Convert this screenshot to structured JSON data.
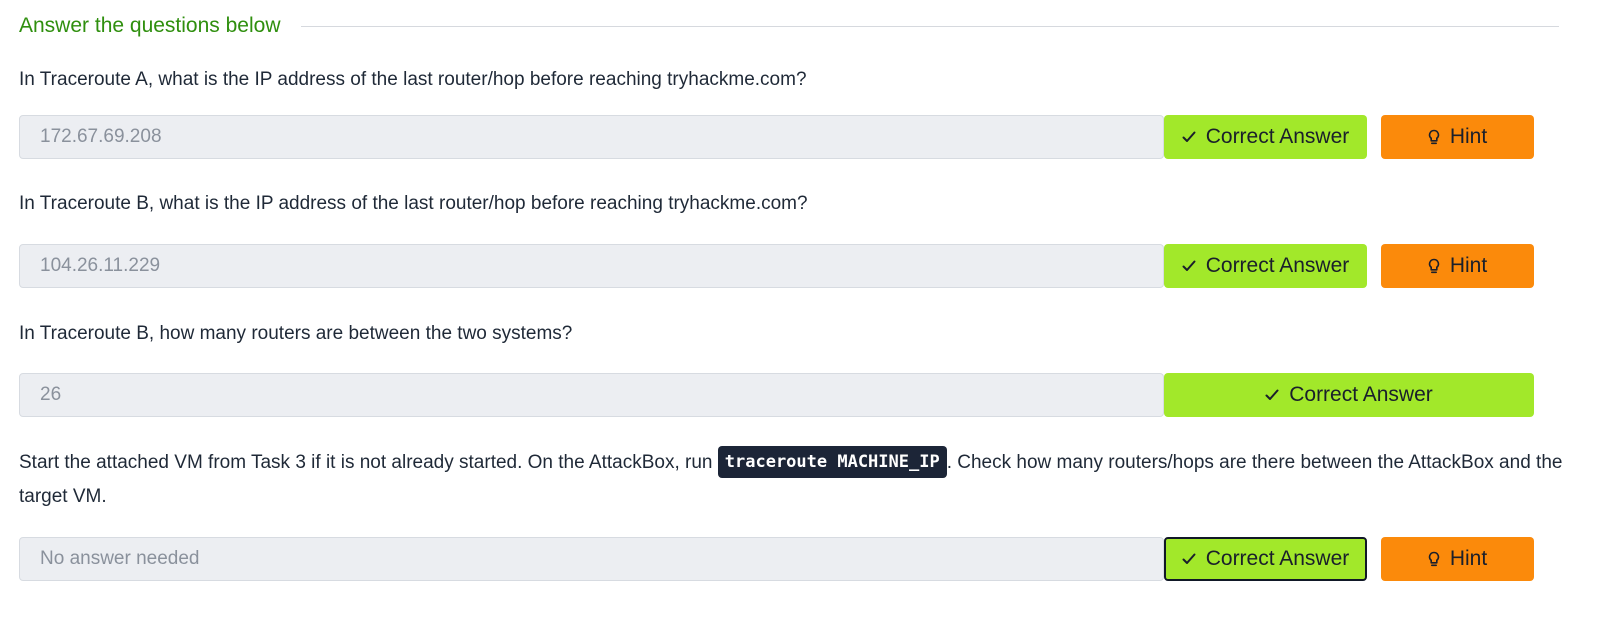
{
  "section": {
    "title": "Answer the questions below"
  },
  "questions": [
    {
      "text": "In Traceroute A, what is the IP address of the last router/hop before reaching tryhackme.com?",
      "answer": "172.67.69.208",
      "correct_label": "Correct Answer",
      "hint_label": "Hint"
    },
    {
      "text": "In Traceroute B, what is the IP address of the last router/hop before reaching tryhackme.com?",
      "answer": "104.26.11.229",
      "correct_label": "Correct Answer",
      "hint_label": "Hint"
    },
    {
      "text": "In Traceroute B, how many routers are between the two systems?",
      "answer": "26",
      "correct_label": "Correct Answer"
    },
    {
      "text_before": "Start the attached VM from Task 3 if it is not already started. On the AttackBox, run ",
      "code": "traceroute MACHINE_IP",
      "text_after": ". Check how many routers/hops are there between the AttackBox and the target VM.",
      "answer": "No answer needed",
      "correct_label": "Correct Answer",
      "hint_label": "Hint"
    }
  ],
  "icons": {
    "correct": "check-icon",
    "hint": "lightbulb-icon"
  },
  "colors": {
    "header": "#2f8f0e",
    "correct_button": "#a2e82a",
    "hint_button": "#fb8a0b",
    "code_background": "#1c2537",
    "answer_field": "#eceef2"
  }
}
